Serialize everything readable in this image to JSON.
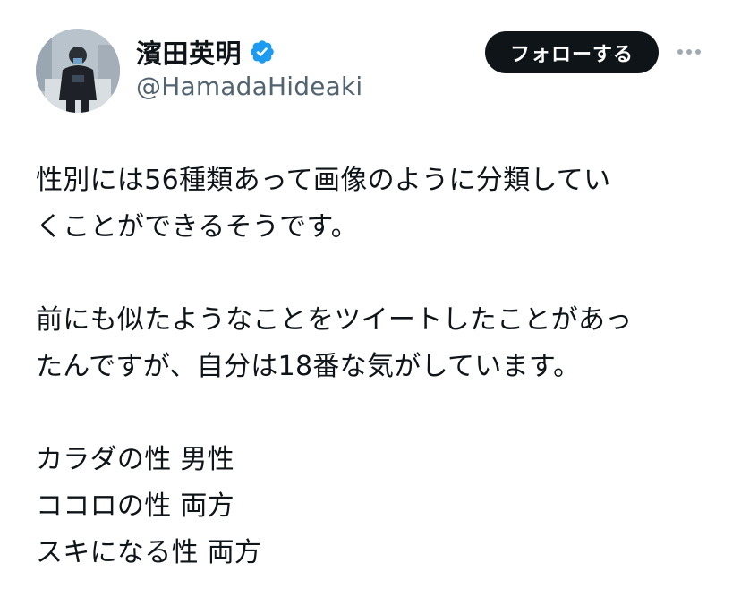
{
  "author": {
    "display_name": "濱田英明",
    "handle": "@HamadaHideaki",
    "verified": true,
    "verified_color": "#1d9bf0"
  },
  "actions": {
    "follow_label": "フォローする",
    "more_icon": "more-horizontal-icon"
  },
  "tweet": {
    "paragraphs": [
      {
        "lines": [
          "性別には56種類あって画像のように分類してい",
          "くことができるそうです。"
        ]
      },
      {
        "lines": [
          "前にも似たようなことをツイートしたことがあっ",
          "たんですが、自分は18番な気がしています。"
        ]
      },
      {
        "lines": [
          "カラダの性 男性",
          "ココロの性 両方",
          "スキになる性 両方"
        ]
      }
    ]
  }
}
